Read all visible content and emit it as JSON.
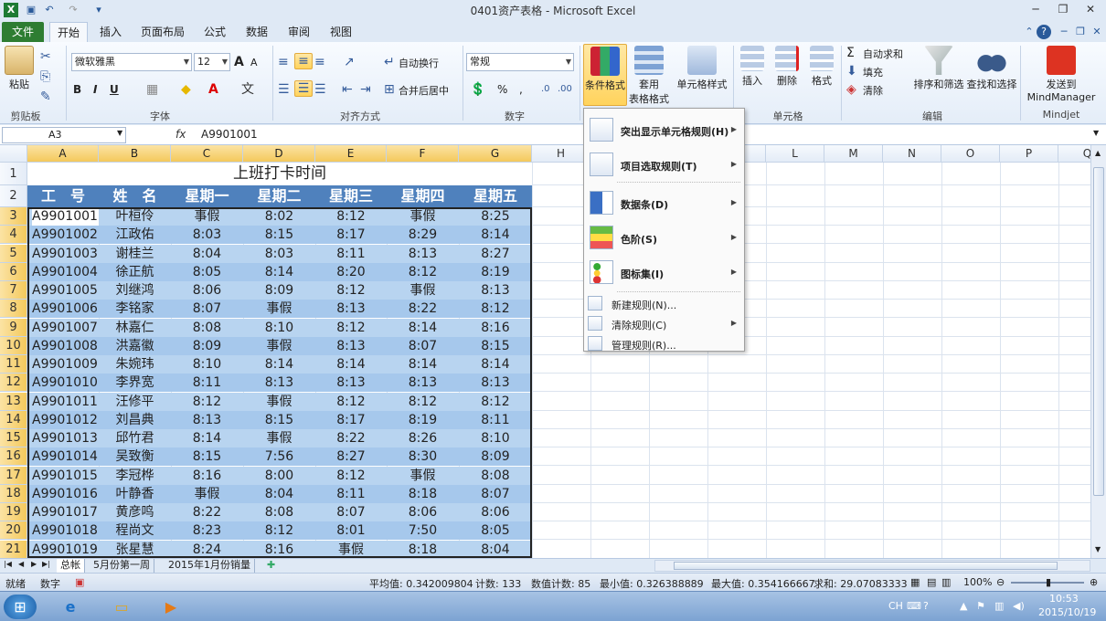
{
  "window": {
    "title": "0401资产表格 - Microsoft Excel"
  },
  "tabs": [
    "文件",
    "开始",
    "插入",
    "页面布局",
    "公式",
    "数据",
    "审阅",
    "视图"
  ],
  "ribbon": {
    "clipboard": {
      "paste": "粘贴",
      "group": "剪贴板"
    },
    "font": {
      "name": "微软雅黑",
      "size": "12",
      "bold": "B",
      "italic": "I",
      "underline": "U",
      "group": "字体"
    },
    "alignment": {
      "wrap": "自动换行",
      "merge": "合并后居中",
      "group": "对齐方式"
    },
    "number": {
      "format": "常规",
      "percent": "%",
      "comma": ",",
      "group": "数字"
    },
    "styles": {
      "conditional": "条件格式",
      "table1": "套用",
      "table2": "表格格式",
      "cellstyle": "单元格样式"
    },
    "cells": {
      "insert": "插入",
      "delete": "删除",
      "format": "格式",
      "group": "单元格"
    },
    "editing": {
      "autosum": "自动求和",
      "fill": "填充",
      "clear": "清除",
      "sort": "排序和筛选",
      "find": "查找和选择",
      "group": "编辑"
    },
    "mindjet": {
      "send1": "发送到",
      "send2": "MindManager",
      "group": "Mindjet"
    }
  },
  "formula_bar": {
    "name_box": "A3",
    "fx": "fx",
    "formula": "A9901001"
  },
  "columns": [
    "A",
    "B",
    "C",
    "D",
    "E",
    "F",
    "G",
    "H",
    "I",
    "J",
    "K",
    "L",
    "M",
    "N",
    "O",
    "P",
    "Q"
  ],
  "rows": [
    "1",
    "2",
    "3",
    "4",
    "5",
    "6",
    "7",
    "8",
    "9",
    "10",
    "11",
    "12",
    "13",
    "14",
    "15",
    "16",
    "17",
    "18",
    "19",
    "20",
    "21"
  ],
  "sheet": {
    "title": "上班打卡时间",
    "headers": [
      "工　号",
      "姓　名",
      "星期一",
      "星期二",
      "星期三",
      "星期四",
      "星期五"
    ],
    "rows": [
      [
        "A9901001",
        "叶桓伶",
        "事假",
        "8:02",
        "8:12",
        "事假",
        "8:25"
      ],
      [
        "A9901002",
        "江政佑",
        "8:03",
        "8:15",
        "8:17",
        "8:29",
        "8:14"
      ],
      [
        "A9901003",
        "谢桂兰",
        "8:04",
        "8:03",
        "8:11",
        "8:13",
        "8:27"
      ],
      [
        "A9901004",
        "徐正航",
        "8:05",
        "8:14",
        "8:20",
        "8:12",
        "8:19"
      ],
      [
        "A9901005",
        "刘继鸿",
        "8:06",
        "8:09",
        "8:12",
        "事假",
        "8:13"
      ],
      [
        "A9901006",
        "李铭家",
        "8:07",
        "事假",
        "8:13",
        "8:22",
        "8:12"
      ],
      [
        "A9901007",
        "林嘉仁",
        "8:08",
        "8:10",
        "8:12",
        "8:14",
        "8:16"
      ],
      [
        "A9901008",
        "洪嘉徽",
        "8:09",
        "事假",
        "8:13",
        "8:07",
        "8:15"
      ],
      [
        "A9901009",
        "朱婉玮",
        "8:10",
        "8:14",
        "8:14",
        "8:14",
        "8:14"
      ],
      [
        "A9901010",
        "李界宽",
        "8:11",
        "8:13",
        "8:13",
        "8:13",
        "8:13"
      ],
      [
        "A9901011",
        "汪修平",
        "8:12",
        "事假",
        "8:12",
        "8:12",
        "8:12"
      ],
      [
        "A9901012",
        "刘昌典",
        "8:13",
        "8:15",
        "8:17",
        "8:19",
        "8:11"
      ],
      [
        "A9901013",
        "邱竹君",
        "8:14",
        "事假",
        "8:22",
        "8:26",
        "8:10"
      ],
      [
        "A9901014",
        "吴致衡",
        "8:15",
        "7:56",
        "8:27",
        "8:30",
        "8:09"
      ],
      [
        "A9901015",
        "李冠桦",
        "8:16",
        "8:00",
        "8:12",
        "事假",
        "8:08"
      ],
      [
        "A9901016",
        "叶静香",
        "事假",
        "8:04",
        "8:11",
        "8:18",
        "8:07"
      ],
      [
        "A9901017",
        "黄彦鸣",
        "8:22",
        "8:08",
        "8:07",
        "8:06",
        "8:06"
      ],
      [
        "A9901018",
        "程尚文",
        "8:23",
        "8:12",
        "8:01",
        "7:50",
        "8:05"
      ],
      [
        "A9901019",
        "张星慧",
        "8:24",
        "8:16",
        "事假",
        "8:18",
        "8:04"
      ]
    ]
  },
  "cf_menu": {
    "items": [
      "突出显示单元格规则(H)",
      "项目选取规则(T)",
      "数据条(D)",
      "色阶(S)",
      "图标集(I)"
    ],
    "small_items": [
      "新建规则(N)...",
      "清除规则(C)",
      "管理规则(R)..."
    ]
  },
  "sheet_tabs": [
    "总帐",
    "5月份第一周",
    "2015年1月份销量"
  ],
  "status": {
    "ready": "就绪",
    "mode": "数字",
    "average": "平均值: 0.342009804",
    "count": "计数: 133",
    "numcount": "数值计数: 85",
    "min": "最小值: 0.326388889",
    "max": "最大值: 0.354166667",
    "sum": "求和: 29.07083333",
    "zoom": "100%"
  },
  "taskbar": {
    "lang": "CH",
    "time": "10:53",
    "date": "2015/10/19"
  }
}
